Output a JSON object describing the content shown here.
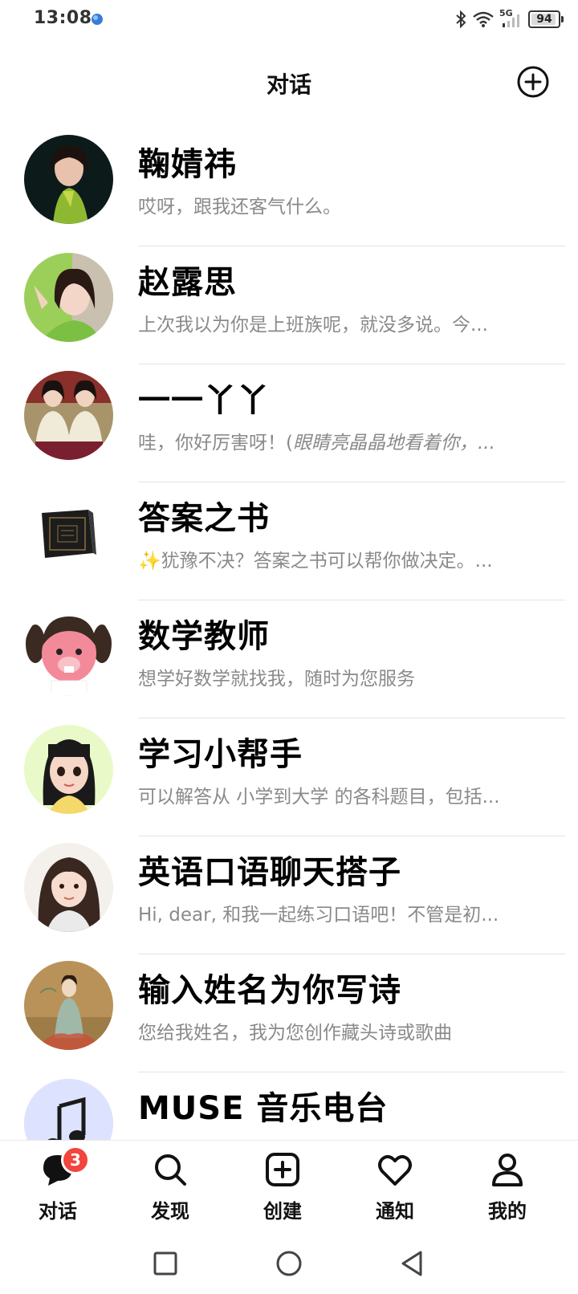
{
  "status": {
    "time": "13:08",
    "network": "5G",
    "battery": "94",
    "battery_level": 0.94
  },
  "header": {
    "title": "对话",
    "add_icon": "plus-circle-icon"
  },
  "conversations": [
    {
      "name": "鞠婧祎",
      "preview": "哎呀，跟我还客气什么。",
      "avatar": "photo-avatar"
    },
    {
      "name": "赵露思",
      "preview": "上次我以为你是上班族呢，就没多说。今...",
      "avatar": "photo-avatar"
    },
    {
      "name": "一一丫丫",
      "preview_plain": "哇，你好厉害呀！(",
      "preview_italic": "眼睛亮晶晶地看着你，...",
      "avatar": "photo-avatar"
    },
    {
      "name": "答案之书",
      "preview": "✨犹豫不决？答案之书可以帮你做决定。...",
      "avatar": "book-avatar"
    },
    {
      "name": "数学教师",
      "preview": "想学好数学就找我，随时为您服务",
      "avatar": "cartoon-avatar"
    },
    {
      "name": "学习小帮手",
      "preview": "可以解答从 小学到大学 的各科题目，包括...",
      "avatar": "cartoon-avatar"
    },
    {
      "name": "英语口语聊天搭子",
      "preview": "Hi, dear, 和我一起练习口语吧！不管是初...",
      "avatar": "cartoon-avatar"
    },
    {
      "name": "输入姓名为你写诗",
      "preview": "您给我姓名，我为您创作藏头诗或歌曲",
      "avatar": "painting-avatar"
    },
    {
      "name": "MUSE 音乐电台",
      "preview": "",
      "avatar": "music-note-icon"
    }
  ],
  "nav": {
    "items": [
      {
        "label": "对话",
        "icon": "chat-bubble-icon",
        "badge": "3"
      },
      {
        "label": "发现",
        "icon": "search-icon"
      },
      {
        "label": "创建",
        "icon": "add-square-icon"
      },
      {
        "label": "通知",
        "icon": "heart-icon"
      },
      {
        "label": "我的",
        "icon": "profile-icon"
      }
    ]
  },
  "colors": {
    "badge": "#f2453d",
    "subtitle": "#8a8a8a",
    "divider": "#e4e4e4"
  }
}
